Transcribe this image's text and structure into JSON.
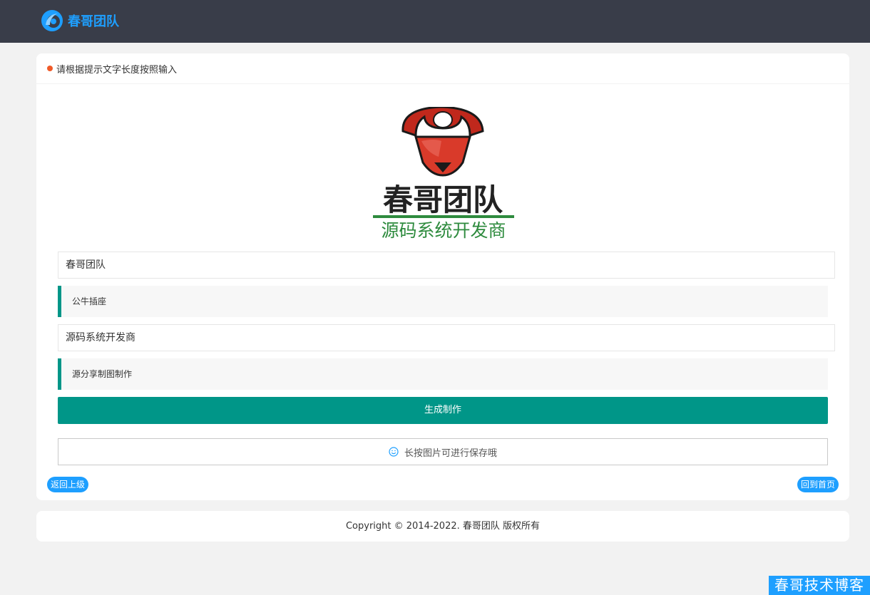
{
  "header": {
    "brand_name": "春哥团队",
    "brand_color": "#1e9fff",
    "bar_color": "#393d49"
  },
  "card": {
    "notice": "请根据提示文字长度按照输入",
    "logo": {
      "title": "春哥团队",
      "subtitle": "源码系统开发商"
    },
    "fields": [
      {
        "value": "春哥团队",
        "hint": "公牛插座"
      },
      {
        "value": "源码系统开发商",
        "hint": "源分享制图制作"
      }
    ],
    "generate_label": "生成制作",
    "save_hint": "长按图片可进行保存哦",
    "back_label": "返回上级",
    "home_label": "回到首页",
    "accent": "#009688"
  },
  "footer": {
    "copyright": "Copyright © 2014-2022. 春哥团队 版权所有"
  },
  "watermark": "春哥技术博客"
}
